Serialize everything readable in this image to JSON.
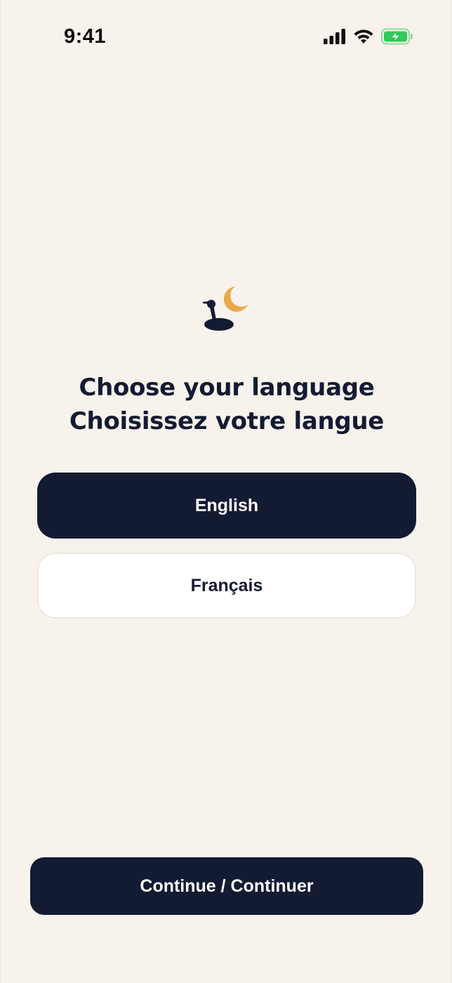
{
  "status_bar": {
    "time": "9:41",
    "icons": [
      "signal-icon",
      "wifi-icon",
      "battery-charging-icon"
    ]
  },
  "logo": {
    "icon": "telescope-moon-logo",
    "colors": {
      "moon": "#e8a94b",
      "telescope": "#131b33"
    }
  },
  "heading": {
    "line_en": "Choose your language",
    "line_fr": "Choisissez votre langue"
  },
  "languages": [
    {
      "label": "English",
      "selected": true
    },
    {
      "label": "Français",
      "selected": false
    }
  ],
  "continue_button": {
    "label": "Continue / Continuer"
  },
  "colors": {
    "background": "#f7f2eb",
    "primary": "#131b33",
    "surface": "#ffffff",
    "battery": "#34c759"
  }
}
